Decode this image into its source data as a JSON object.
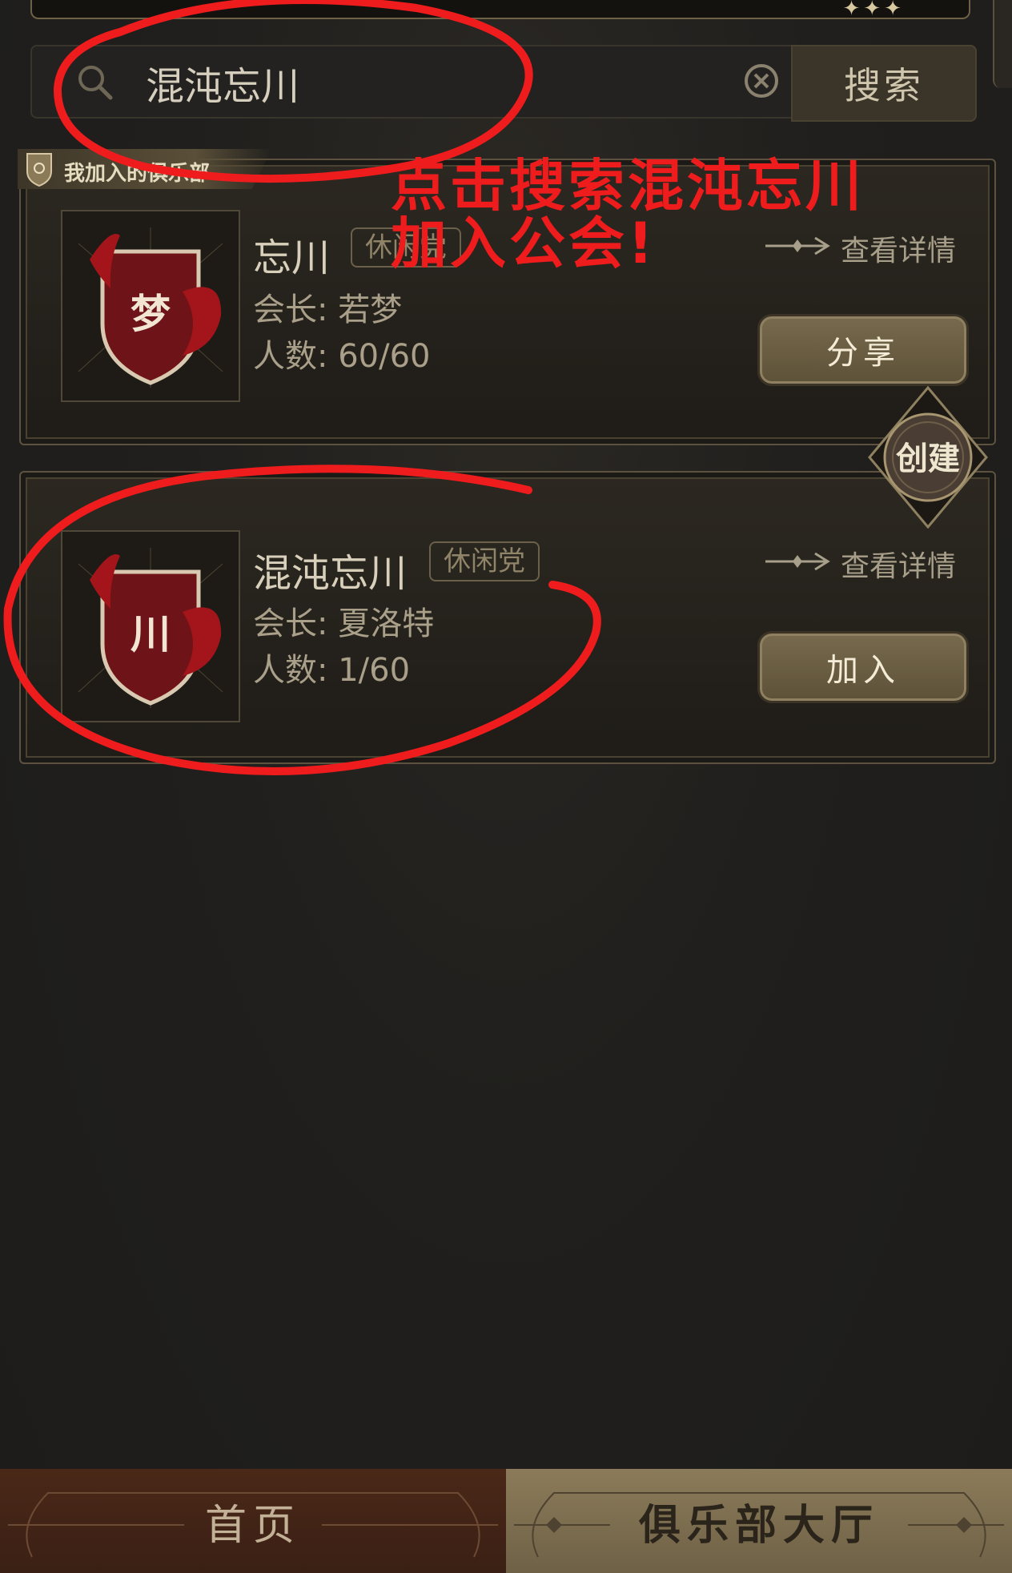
{
  "search": {
    "value": "混沌忘川",
    "button_label": "搜索"
  },
  "joined_section": {
    "label": "我加入的俱乐部"
  },
  "clubs": [
    {
      "emblem_char": "梦",
      "name": "忘川",
      "tag": "休闲党",
      "leader_label": "会长:",
      "leader": "若梦",
      "members_label": "人数:",
      "members": "60/60",
      "detail_label": "查看详情",
      "action_label": "分享"
    },
    {
      "emblem_char": "川",
      "name": "混沌忘川",
      "tag": "休闲党",
      "leader_label": "会长:",
      "leader": "夏洛特",
      "members_label": "人数:",
      "members": "1/60",
      "detail_label": "查看详情",
      "action_label": "加入"
    }
  ],
  "create_button": {
    "label": "创建"
  },
  "annotation": {
    "line1": "点击搜索混沌忘川",
    "line2": "加入公会!",
    "color": "#ee1c1c"
  },
  "bottom_nav": {
    "home": "首页",
    "hall": "俱乐部大厅"
  },
  "colors": {
    "background": "#1f1e1c",
    "gold": "#776a4d",
    "emblem_red": "#8b1a1a"
  }
}
